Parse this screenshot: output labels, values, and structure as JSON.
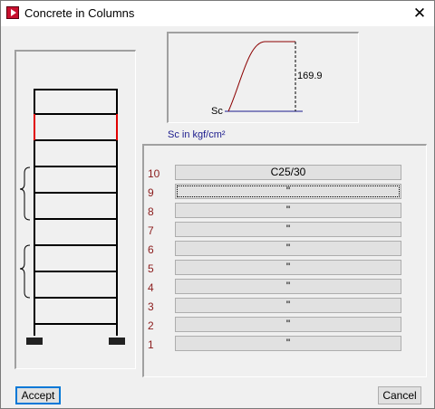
{
  "window": {
    "title": "Concrete in Columns",
    "close_symbol": "✕"
  },
  "curve": {
    "value_label": "169.9",
    "axis_label": "Sc",
    "scale_text": "Sc in kgf/cm²"
  },
  "floors": [
    {
      "number": "10",
      "grade": "C25/30"
    },
    {
      "number": "9",
      "grade": "\""
    },
    {
      "number": "8",
      "grade": "\""
    },
    {
      "number": "7",
      "grade": "\""
    },
    {
      "number": "6",
      "grade": "\""
    },
    {
      "number": "5",
      "grade": "\""
    },
    {
      "number": "4",
      "grade": "\""
    },
    {
      "number": "3",
      "grade": "\""
    },
    {
      "number": "2",
      "grade": "\""
    },
    {
      "number": "1",
      "grade": "\""
    }
  ],
  "buttons": {
    "accept": "Accept",
    "cancel": "Cancel"
  },
  "colors": {
    "highlight_column": "#e00000",
    "curve": "#8b0000",
    "baseline": "#1a1a8c"
  }
}
